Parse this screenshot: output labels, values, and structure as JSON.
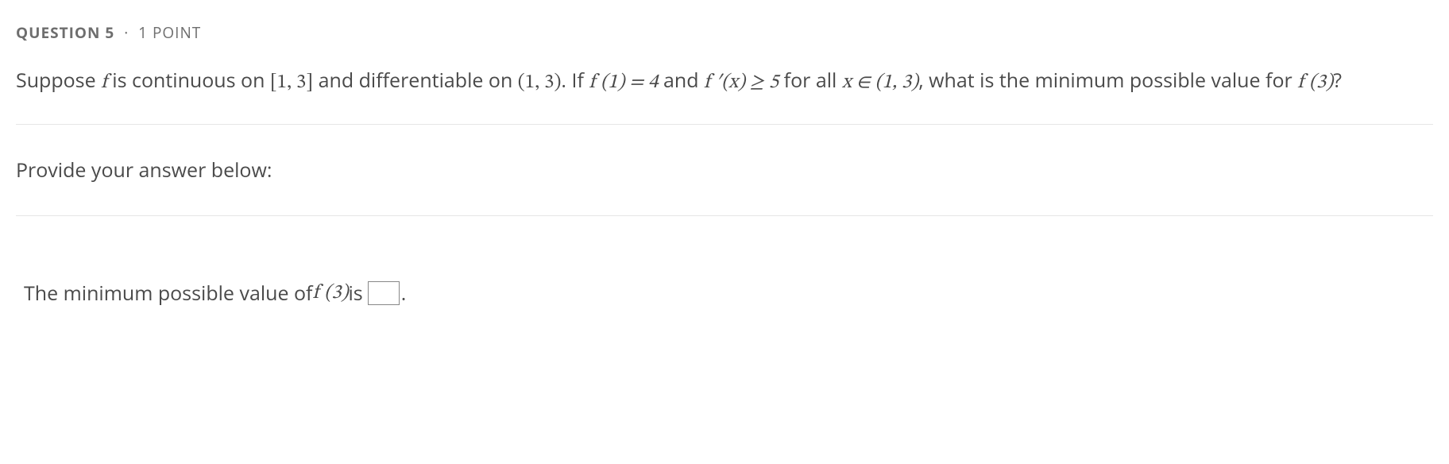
{
  "header": {
    "question_label": "QUESTION 5",
    "separator": "·",
    "points_label": "1 POINT"
  },
  "body": {
    "seg1": "Suppose ",
    "f": "f",
    "seg2": " is continuous on ",
    "interval_closed": "[1, 3]",
    "seg3": " and differentiable on ",
    "interval_open": "(1, 3)",
    "seg4": ". If ",
    "f_of_1": "f (1) = 4",
    "seg5": " and ",
    "fprime": "f ′(x) ≥ 5",
    "seg6": " for all ",
    "x_in": "x ∈ (1, 3)",
    "seg7": ", what is the minimum possible value for ",
    "f_of_3": "f (3)",
    "seg8": "?"
  },
  "prompt": {
    "text": "Provide your answer below:"
  },
  "answer": {
    "prefix": "The minimum possible value of ",
    "f_of_3": "f (3)",
    "is_text": " is ",
    "value": "",
    "period": "."
  }
}
